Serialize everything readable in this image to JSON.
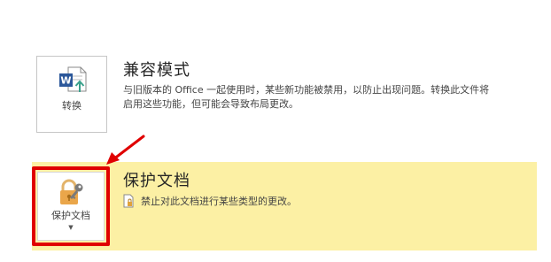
{
  "compat": {
    "button_label": "转换",
    "title": "兼容模式",
    "desc_line1": "与旧版本的 Office 一起使用时，某些新功能被禁用，以防止出现问题。转换此文件将",
    "desc_line2": "启用这些功能，但可能会导致布局更改。",
    "icon": "word-convert-icon"
  },
  "protect": {
    "button_label": "保护文档",
    "title": "保护文档",
    "desc": "禁止对此文档进行某些类型的更改。",
    "icon": "lock-key-icon",
    "panel_color": "#fcf0a4"
  },
  "colors": {
    "highlight": "#e00000",
    "word_blue": "#2b579a"
  }
}
